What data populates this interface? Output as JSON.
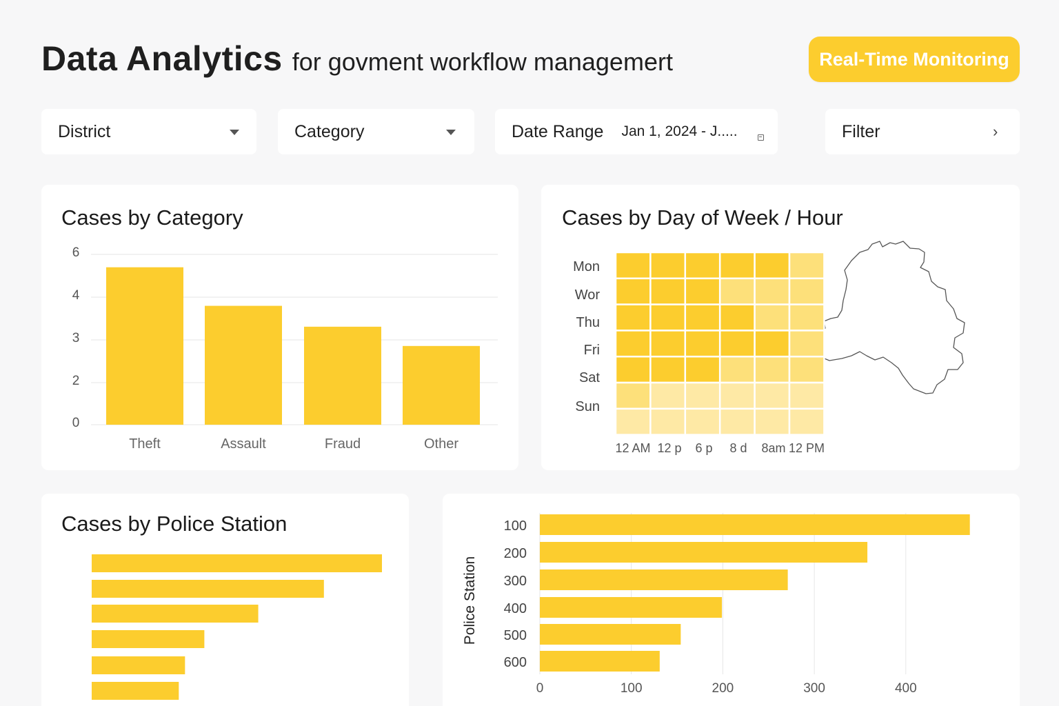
{
  "header": {
    "title": "Data Analytics",
    "subtitle": "for govment workflow managemert",
    "realtime_button": "Real-Time Monitoring"
  },
  "filters": {
    "district": "District",
    "category": "Category",
    "date_range_label": "Date Range",
    "date_range_value": "Jan 1, 2024 - J.....",
    "filter_label": "Filter"
  },
  "cards": {
    "category_title": "Cases by Category",
    "heatmap_title": "Cases by Day of Week / Hour",
    "station_title": "Cases by Police Station"
  },
  "colors": {
    "accent": "#fccd2e",
    "heat_high": "#fccd2e",
    "heat_mid": "#fde07a",
    "heat_low": "#fee9a5",
    "grid": "#e6e6e6"
  },
  "chart_data": [
    {
      "id": "cases_by_category",
      "type": "bar",
      "categories": [
        "Theft",
        "Assault",
        "Fraud",
        "Other"
      ],
      "values": [
        4.9,
        3.7,
        3.05,
        2.45
      ],
      "ytick_labels": [
        "6",
        "4",
        "3",
        "2",
        "0"
      ],
      "grid": true
    },
    {
      "id": "cases_by_day_hour",
      "type": "heatmap",
      "rows": [
        "Mon",
        "Wor",
        "Thu",
        "Fri",
        "Sat",
        "Sun",
        ""
      ],
      "columns": [
        "12 AM",
        "12 p",
        "6 p",
        "8 d",
        "8am",
        "12 PM"
      ],
      "levels": [
        [
          3,
          3,
          3,
          3,
          3,
          2
        ],
        [
          3,
          3,
          3,
          2,
          2,
          2
        ],
        [
          3,
          3,
          3,
          3,
          2,
          2
        ],
        [
          3,
          3,
          3,
          3,
          3,
          2
        ],
        [
          3,
          3,
          3,
          2,
          2,
          2
        ],
        [
          2,
          1,
          1,
          1,
          1,
          1
        ],
        [
          1,
          1,
          1,
          1,
          1,
          1
        ]
      ],
      "map_icon": "district-outline-map"
    },
    {
      "id": "cases_by_police_station_small",
      "type": "bar",
      "orientation": "horizontal",
      "values": [
        420,
        336,
        241,
        163,
        135,
        126
      ]
    },
    {
      "id": "cases_by_police_station",
      "type": "bar",
      "orientation": "horizontal",
      "categories": [
        "100",
        "200",
        "300",
        "400",
        "500",
        "600"
      ],
      "values": [
        470,
        358,
        271,
        199,
        154,
        131
      ],
      "ylabel": "Police Station",
      "xticks": [
        0,
        100,
        200,
        300,
        400
      ],
      "xlim": [
        0,
        470
      ],
      "grid": true
    }
  ]
}
